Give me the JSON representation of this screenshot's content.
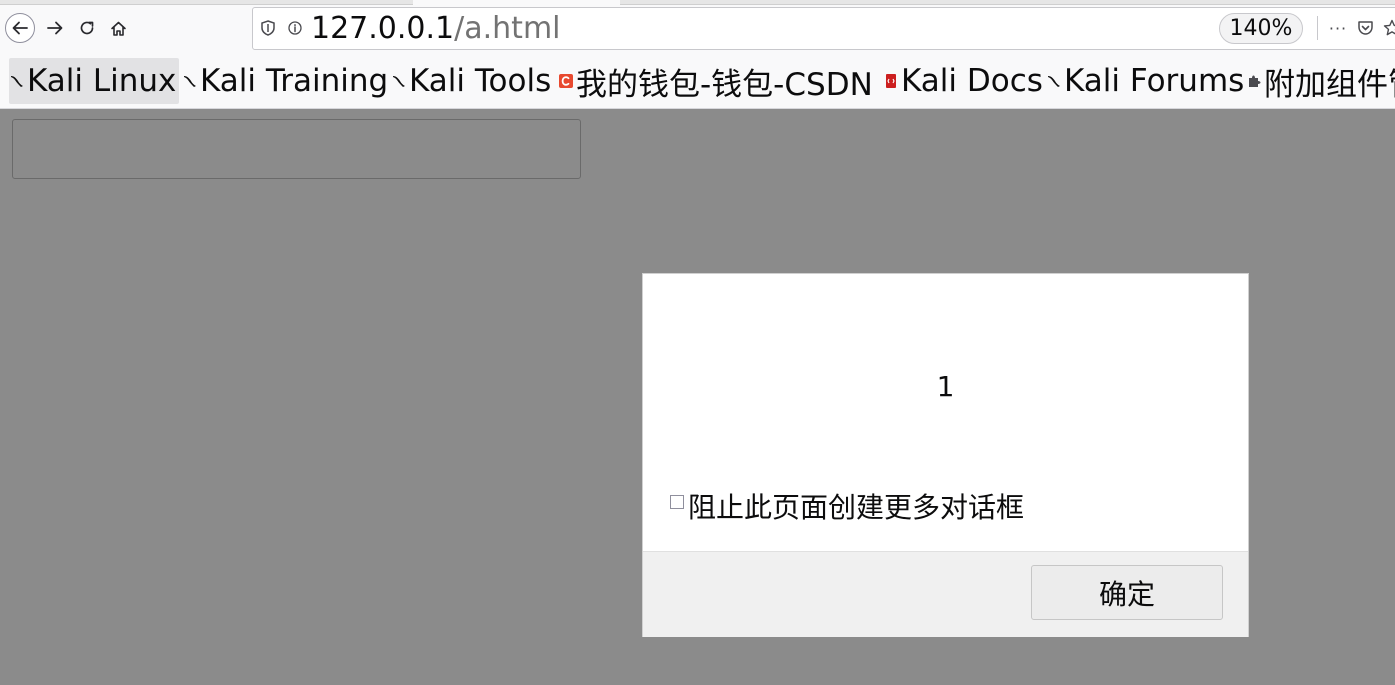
{
  "browser": {
    "url": {
      "host": "127.0.0.1",
      "path": "/a.html"
    },
    "zoom": "140%",
    "more_menu_glyph": "···",
    "icons": {
      "back": "back-arrow-icon",
      "forward": "forward-arrow-icon",
      "reload": "reload-icon",
      "home": "home-icon",
      "tracking": "shield-icon",
      "site_info": "info-icon",
      "more": "more-icon",
      "pocket": "pocket-icon",
      "bookmark_star": "star-icon"
    }
  },
  "bookmarks": [
    {
      "label": "Kali Linux",
      "icon": "kali-dragon-icon"
    },
    {
      "label": "Kali Training",
      "icon": "kali-dragon-icon"
    },
    {
      "label": "Kali Tools",
      "icon": "kali-dragon-icon"
    },
    {
      "label": "我的钱包-钱包-CSDN",
      "icon": "csdn-icon"
    },
    {
      "label": "Kali Docs",
      "icon": "kali-docs-icon"
    },
    {
      "label": "Kali Forums",
      "icon": "kali-dragon-icon"
    },
    {
      "label": "附加组件管",
      "icon": "puzzle-piece-icon"
    }
  ],
  "colors": {
    "overlay": "#8b8b8b",
    "csdn_red": "#e8492f",
    "docs_red": "#cc1f1f"
  },
  "dialog": {
    "message": "1",
    "checkbox_label": "阻止此页面创建更多对话框",
    "checkbox_checked": false,
    "ok_label": "确定"
  }
}
